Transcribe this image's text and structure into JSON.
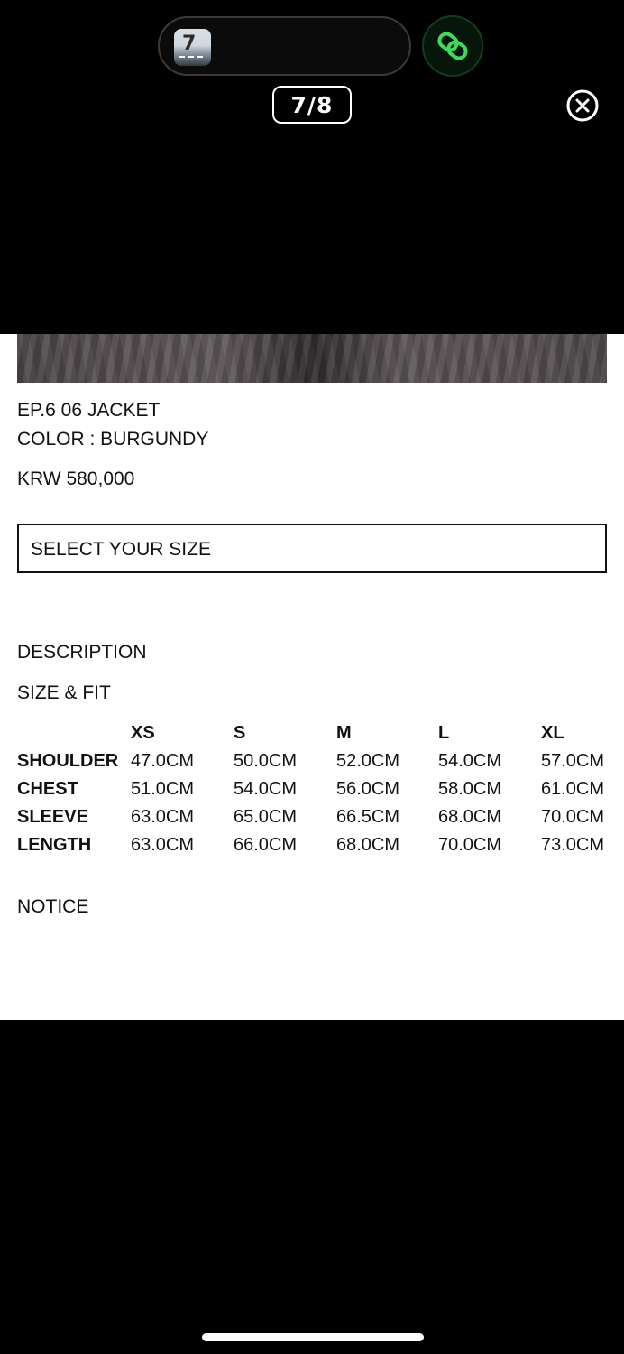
{
  "overlay": {
    "counter": "7/8",
    "thumb_glyph": "7"
  },
  "product": {
    "name": "EP.6 06 JACKET",
    "color": "COLOR : BURGUNDY",
    "price": "KRW 580,000",
    "size_select_placeholder": "SELECT YOUR SIZE"
  },
  "sections": {
    "description": "DESCRIPTION",
    "size_fit": "SIZE & FIT",
    "notice": "NOTICE"
  },
  "size_table": {
    "sizes": [
      "XS",
      "S",
      "M",
      "L",
      "XL"
    ],
    "rows": [
      {
        "label": "SHOULDER",
        "values": [
          "47.0CM",
          "50.0CM",
          "52.0CM",
          "54.0CM",
          "57.0CM"
        ]
      },
      {
        "label": "CHEST",
        "values": [
          "51.0CM",
          "54.0CM",
          "56.0CM",
          "58.0CM",
          "61.0CM"
        ]
      },
      {
        "label": "SLEEVE",
        "values": [
          "63.0CM",
          "65.0CM",
          "66.5CM",
          "68.0CM",
          "70.0CM"
        ]
      },
      {
        "label": "LENGTH",
        "values": [
          "63.0CM",
          "66.0CM",
          "68.0CM",
          "70.0CM",
          "73.0CM"
        ]
      }
    ]
  },
  "colors": {
    "link_icon": "#3ddc5c",
    "background": "#000000",
    "panel": "#ffffff"
  }
}
